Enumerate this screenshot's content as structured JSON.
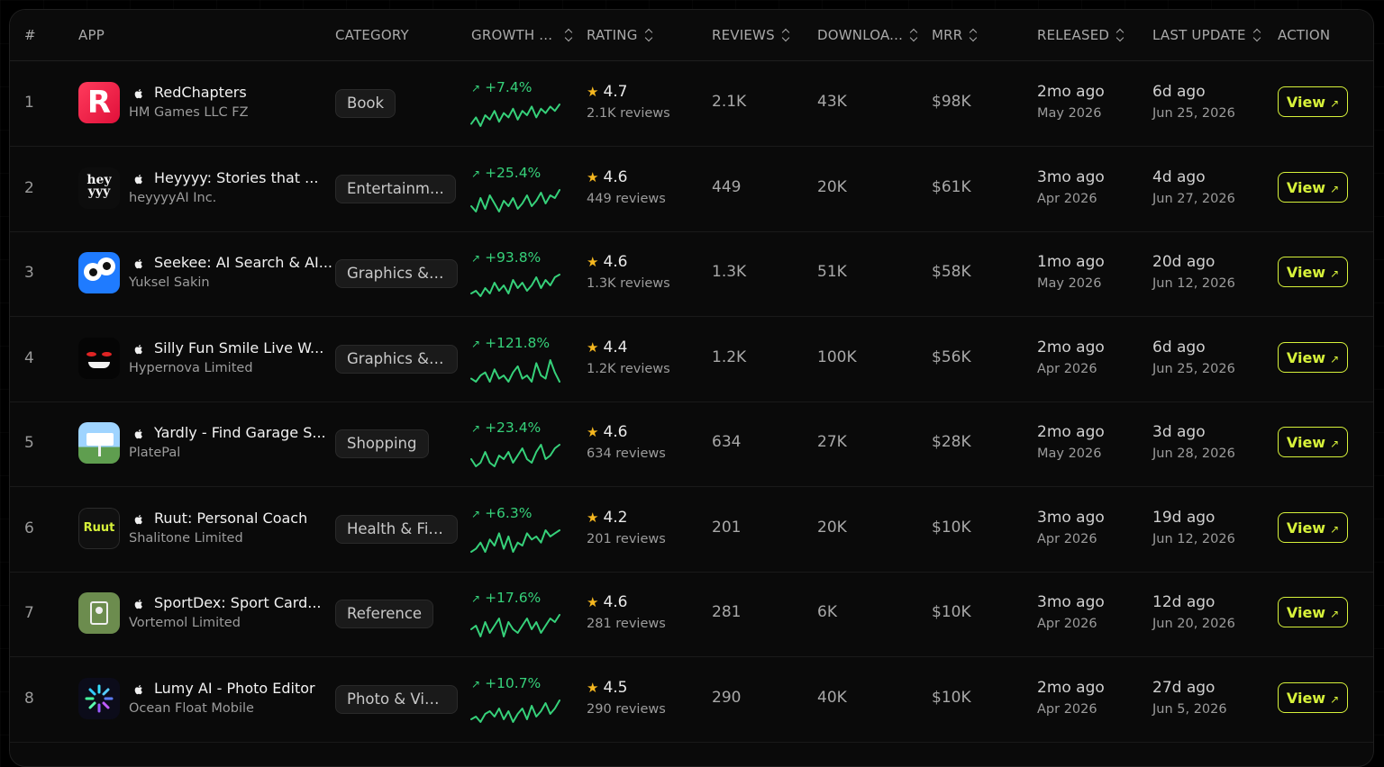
{
  "headers": {
    "rank": "#",
    "app": "APP",
    "category": "CATEGORY",
    "growth": "GROWTH ...",
    "rating": "RATING",
    "reviews": "REVIEWS",
    "downloads": "DOWNLOA...",
    "mrr": "MRR",
    "released": "RELEASED",
    "last_update": "LAST UPDATE",
    "action": "ACTION"
  },
  "colors": {
    "accent": "#d7f23a",
    "growth": "#36d17a",
    "star": "#f5b71f"
  },
  "rows": [
    {
      "rank": "1",
      "name": "RedChapters",
      "developer": "HM Games LLC FZ",
      "category": "Book",
      "growth": "+7.4%",
      "spark": [
        9,
        6,
        10,
        5,
        7,
        3,
        8,
        4,
        6,
        2,
        7,
        3,
        5,
        1,
        6,
        2,
        4,
        1,
        3,
        0
      ],
      "rating": "4.7",
      "rating_sub": "2.1K reviews",
      "reviews": "2.1K",
      "downloads": "43K",
      "mrr": "$98K",
      "released_ago": "2mo ago",
      "released_date": "May 2026",
      "updated_ago": "6d ago",
      "updated_date": "Jun 25, 2026",
      "action": "View",
      "icon": "redchapters-icon"
    },
    {
      "rank": "2",
      "name": "Heyyyy: Stories that ...",
      "developer": "heyyyyAI Inc.",
      "category": "Entertainm...",
      "growth": "+25.4%",
      "spark": [
        7,
        9,
        4,
        8,
        3,
        6,
        9,
        5,
        7,
        4,
        8,
        6,
        3,
        7,
        5,
        2,
        6,
        3,
        4,
        1
      ],
      "rating": "4.6",
      "rating_sub": "449 reviews",
      "reviews": "449",
      "downloads": "20K",
      "mrr": "$61K",
      "released_ago": "3mo ago",
      "released_date": "Apr 2026",
      "updated_ago": "4d ago",
      "updated_date": "Jun 27, 2026",
      "action": "View",
      "icon": "heyyyy-icon"
    },
    {
      "rank": "3",
      "name": "Seekee: AI Search & AI...",
      "developer": "Yuksel Sakin",
      "category": "Graphics & ...",
      "growth": "+93.8%",
      "spark": [
        8,
        7,
        9,
        6,
        8,
        4,
        7,
        5,
        8,
        3,
        6,
        4,
        7,
        5,
        2,
        6,
        3,
        5,
        2,
        1
      ],
      "rating": "4.6",
      "rating_sub": "1.3K reviews",
      "reviews": "1.3K",
      "downloads": "51K",
      "mrr": "$58K",
      "released_ago": "1mo ago",
      "released_date": "May 2026",
      "updated_ago": "20d ago",
      "updated_date": "Jun 12, 2026",
      "action": "View",
      "icon": "seekee-icon"
    },
    {
      "rank": "4",
      "name": "Silly Fun Smile Live W...",
      "developer": "Hypernova Limited",
      "category": "Graphics & ...",
      "growth": "+121.8%",
      "spark": [
        8,
        9,
        7,
        6,
        9,
        5,
        8,
        7,
        9,
        6,
        4,
        8,
        7,
        9,
        3,
        7,
        8,
        2,
        6,
        9
      ],
      "rating": "4.4",
      "rating_sub": "1.2K reviews",
      "reviews": "1.2K",
      "downloads": "100K",
      "mrr": "$56K",
      "released_ago": "2mo ago",
      "released_date": "Apr 2026",
      "updated_ago": "6d ago",
      "updated_date": "Jun 25, 2026",
      "action": "View",
      "icon": "silly-smile-icon"
    },
    {
      "rank": "5",
      "name": "Yardly - Find Garage S...",
      "developer": "PlatePal",
      "category": "Shopping",
      "growth": "+23.4%",
      "spark": [
        7,
        9,
        8,
        5,
        8,
        9,
        6,
        7,
        5,
        8,
        6,
        4,
        7,
        8,
        5,
        3,
        7,
        6,
        4,
        3
      ],
      "rating": "4.6",
      "rating_sub": "634 reviews",
      "reviews": "634",
      "downloads": "27K",
      "mrr": "$28K",
      "released_ago": "2mo ago",
      "released_date": "May 2026",
      "updated_ago": "3d ago",
      "updated_date": "Jun 28, 2026",
      "action": "View",
      "icon": "yardly-icon"
    },
    {
      "rank": "6",
      "name": "Ruut: Personal Coach",
      "developer": "Shalitone Limited",
      "category": "Health & Fit...",
      "growth": "+6.3%",
      "spark": [
        9,
        8,
        6,
        9,
        5,
        7,
        3,
        8,
        4,
        9,
        6,
        7,
        3,
        5,
        4,
        6,
        2,
        4,
        3,
        2
      ],
      "rating": "4.2",
      "rating_sub": "201 reviews",
      "reviews": "201",
      "downloads": "20K",
      "mrr": "$10K",
      "released_ago": "3mo ago",
      "released_date": "Apr 2026",
      "updated_ago": "19d ago",
      "updated_date": "Jun 12, 2026",
      "action": "View",
      "icon": "ruut-icon"
    },
    {
      "rank": "7",
      "name": "SportDex: Sport Card...",
      "developer": "Vortemol Limited",
      "category": "Reference",
      "growth": "+17.6%",
      "spark": [
        7,
        6,
        9,
        5,
        8,
        6,
        4,
        9,
        5,
        7,
        8,
        6,
        4,
        7,
        5,
        8,
        6,
        4,
        5,
        3
      ],
      "rating": "4.6",
      "rating_sub": "281 reviews",
      "reviews": "281",
      "downloads": "6K",
      "mrr": "$10K",
      "released_ago": "3mo ago",
      "released_date": "Apr 2026",
      "updated_ago": "12d ago",
      "updated_date": "Jun 20, 2026",
      "action": "View",
      "icon": "sportdex-icon"
    },
    {
      "rank": "8",
      "name": "Lumy AI - Photo Editor",
      "developer": "Ocean Float Mobile",
      "category": "Photo & Vid...",
      "growth": "+10.7%",
      "spark": [
        8,
        7,
        9,
        6,
        5,
        7,
        4,
        8,
        5,
        9,
        6,
        4,
        8,
        3,
        7,
        5,
        2,
        6,
        4,
        1
      ],
      "rating": "4.5",
      "rating_sub": "290 reviews",
      "reviews": "290",
      "downloads": "40K",
      "mrr": "$10K",
      "released_ago": "2mo ago",
      "released_date": "Apr 2026",
      "updated_ago": "27d ago",
      "updated_date": "Jun 5, 2026",
      "action": "View",
      "icon": "lumy-icon"
    }
  ]
}
